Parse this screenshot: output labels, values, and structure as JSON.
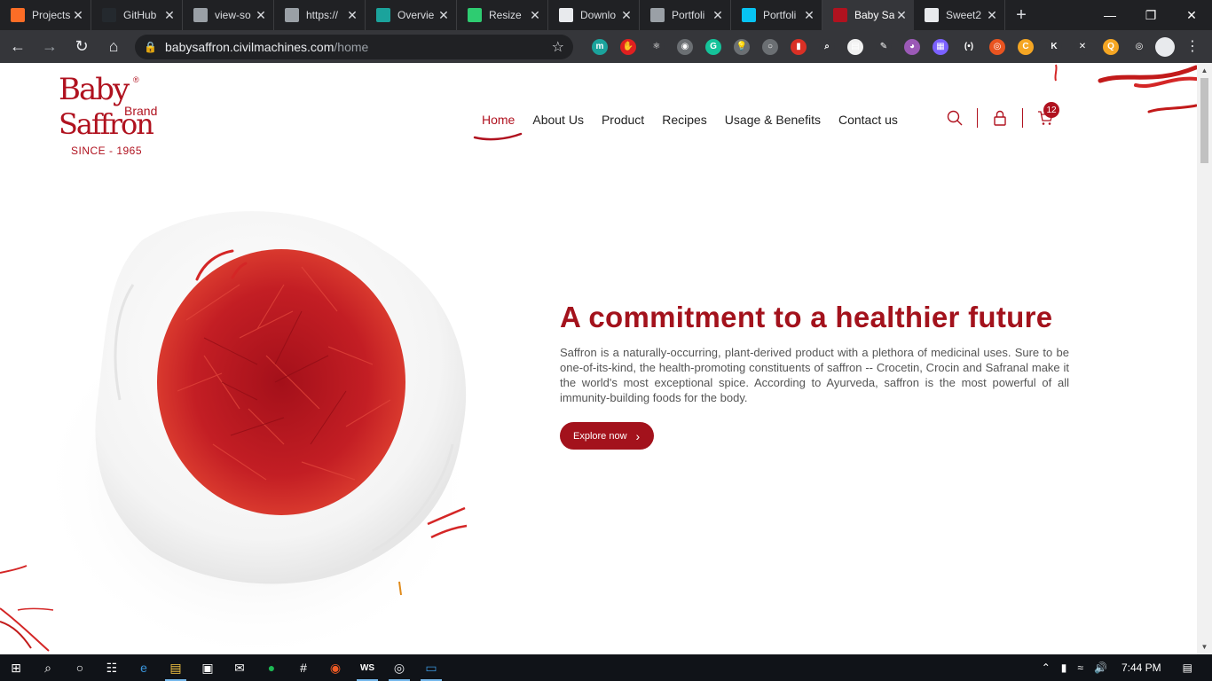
{
  "browser": {
    "tabs": [
      {
        "title": "Projects",
        "icon": "gitlab-icon",
        "color": "#fc6d26",
        "active": false
      },
      {
        "title": "GitHub",
        "icon": "github-icon",
        "color": "#24292e",
        "active": false
      },
      {
        "title": "view-so",
        "icon": "globe-icon",
        "color": "#9aa0a6",
        "active": false
      },
      {
        "title": "https://",
        "icon": "globe-icon",
        "color": "#9aa0a6",
        "active": false
      },
      {
        "title": "Overvie",
        "icon": "diamond-icon",
        "color": "#1ba39c",
        "active": false
      },
      {
        "title": "Resize",
        "icon": "resize-icon",
        "color": "#2ecc71",
        "active": false
      },
      {
        "title": "Downlo",
        "icon": "download-icon",
        "color": "#e8eaed",
        "active": false
      },
      {
        "title": "Portfoli",
        "icon": "globe-icon",
        "color": "#9aa0a6",
        "active": false
      },
      {
        "title": "Portfoli",
        "icon": "webstorm-icon",
        "color": "#07c3f2",
        "active": false
      },
      {
        "title": "Baby Sa",
        "icon": "baby-saffron-favicon",
        "color": "#b0121f",
        "active": true
      },
      {
        "title": "Sweet2",
        "icon": "loading-icon",
        "color": "#e8eaed",
        "active": false
      }
    ],
    "url_host": "babysaffron.civilmachines.com",
    "url_path": "/home",
    "extensions": [
      {
        "name": "m-extension-icon",
        "color": "#1ba39c",
        "glyph": "m"
      },
      {
        "name": "adblock-icon",
        "color": "#e02020",
        "glyph": "✋"
      },
      {
        "name": "react-devtools-icon",
        "color": "#35363a",
        "glyph": "⚛"
      },
      {
        "name": "camera-icon",
        "color": "#6b6f73",
        "glyph": "◉"
      },
      {
        "name": "grammarly-icon",
        "color": "#15c39a",
        "glyph": "G"
      },
      {
        "name": "lightbulb-icon",
        "color": "#6b6f73",
        "glyph": "💡"
      },
      {
        "name": "bulb-icon",
        "color": "#6b6f73",
        "glyph": "○"
      },
      {
        "name": "bookmark-icon",
        "color": "#d93025",
        "glyph": "▮"
      },
      {
        "name": "magnifier-icon",
        "color": "#35363a",
        "glyph": "⌕"
      },
      {
        "name": "notes-icon",
        "color": "#f0f0f0",
        "glyph": "▤"
      },
      {
        "name": "eyedropper-icon",
        "color": "#35363a",
        "glyph": "✎"
      },
      {
        "name": "color-wheel-icon",
        "color": "#9b59b6",
        "glyph": "◕"
      },
      {
        "name": "window-resizer-icon",
        "color": "#7b61ff",
        "glyph": "▦"
      },
      {
        "name": "code-icon",
        "color": "#35363a",
        "glyph": "(•)"
      },
      {
        "name": "ubuntu-icon",
        "color": "#e95420",
        "glyph": "◎"
      },
      {
        "name": "c-extension-icon",
        "color": "#f5a623",
        "glyph": "C"
      },
      {
        "name": "k-extension-icon",
        "color": "#35363a",
        "glyph": "K"
      },
      {
        "name": "x-extension-icon",
        "color": "#35363a",
        "glyph": "✕"
      },
      {
        "name": "q-extension-icon",
        "color": "#f5a623",
        "glyph": "Q"
      },
      {
        "name": "target-icon",
        "color": "#35363a",
        "glyph": "◎"
      }
    ]
  },
  "site": {
    "logo": {
      "line1": "Baby",
      "brand": "Brand",
      "line2": "Saffron",
      "since": "SINCE - 1965",
      "reg": "®"
    },
    "nav": [
      {
        "label": "Home",
        "active": true
      },
      {
        "label": "About Us",
        "active": false
      },
      {
        "label": "Product",
        "active": false
      },
      {
        "label": "Recipes",
        "active": false
      },
      {
        "label": "Usage & Benefits",
        "active": false
      },
      {
        "label": "Contact us",
        "active": false
      }
    ],
    "header_icons": [
      "search-icon",
      "lock-icon",
      "cart-icon"
    ],
    "cart_count": "12",
    "hero": {
      "title": "A commitment to a healthier future",
      "body": "Saffron is a naturally-occurring, plant-derived product with a plethora of medicinal uses. Sure to be one-of-its-kind, the health-promoting constituents of saffron -- Crocetin, Crocin and Safranal make it the world's most exceptional spice. According to Ayurveda, saffron is the most powerful of all immunity-building foods for the body.",
      "cta": "Explore now"
    },
    "brand_color": "#a3121c"
  },
  "taskbar": {
    "apps": [
      "windows-start-icon",
      "search-icon",
      "cortana-icon",
      "task-view-icon",
      "edge-icon",
      "file-explorer-icon",
      "store-icon",
      "mail-icon",
      "spotify-icon",
      "slack-icon",
      "postman-icon",
      "webstorm-icon",
      "chrome-icon",
      "remote-desktop-icon"
    ],
    "time": "7:44 PM"
  }
}
